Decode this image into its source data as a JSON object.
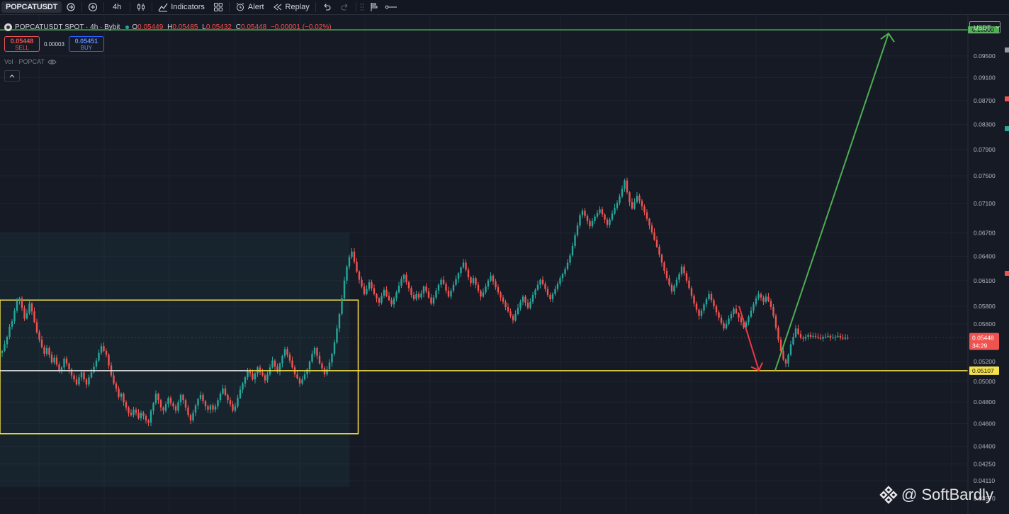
{
  "toolbar": {
    "symbol": "POPCATUSDT",
    "interval": "4h",
    "indicators_label": "Indicators",
    "alert_label": "Alert",
    "replay_label": "Replay"
  },
  "legend": {
    "title": "POPCATUSDT SPOT · 4h · Bybit",
    "o_label": "O",
    "o_value": "0.05449",
    "h_label": "H",
    "h_value": "0.05485",
    "l_label": "L",
    "l_value": "0.05432",
    "c_label": "C",
    "c_value": "0.05448",
    "change": "−0.00001 (−0.02%)"
  },
  "trade": {
    "sell_price": "0.05448",
    "sell_label": "SELL",
    "spread": "0.00003",
    "buy_price": "0.05451",
    "buy_label": "BUY"
  },
  "volume_label": "Vol · POPCAT",
  "currency": "USDT",
  "price_scale": {
    "ticks": [
      "0.09500",
      "0.09100",
      "0.08700",
      "0.08300",
      "0.07900",
      "0.07500",
      "0.07100",
      "0.06700",
      "0.06400",
      "0.06100",
      "0.05800",
      "0.05600",
      "0.05200",
      "0.05000",
      "0.04800",
      "0.04600",
      "0.04400",
      "0.04250",
      "0.04110",
      "0.03970"
    ],
    "top_label": "0.10000",
    "current_price": "0.05448",
    "countdown": "34:29",
    "level_label": "0.05107"
  },
  "watermark": "@ SoftBardly",
  "colors": {
    "up": "#26a69a",
    "down": "#ef5350",
    "support_box": "#f5e14a",
    "target_arrow": "#4caf50",
    "drop_arrow": "#f23645"
  },
  "chart_data": {
    "type": "candlestick",
    "y_scale": "log",
    "ylim": [
      0.0385,
      0.103
    ],
    "series": [
      {
        "name": "POPCATUSDT",
        "close": [
          0.0531,
          0.0538,
          0.0546,
          0.0557,
          0.0563,
          0.0575,
          0.0586,
          0.0589,
          0.0578,
          0.0566,
          0.0572,
          0.0583,
          0.0574,
          0.0562,
          0.0551,
          0.0543,
          0.0535,
          0.0528,
          0.0534,
          0.0527,
          0.0519,
          0.0524,
          0.0517,
          0.0511,
          0.0514,
          0.0523,
          0.0518,
          0.0512,
          0.0506,
          0.0502,
          0.0497,
          0.0504,
          0.0509,
          0.0502,
          0.0497,
          0.0504,
          0.0509,
          0.0515,
          0.0521,
          0.0529,
          0.0536,
          0.0531,
          0.0527,
          0.0516,
          0.0506,
          0.0498,
          0.0493,
          0.0485,
          0.0488,
          0.048,
          0.0475,
          0.047,
          0.0468,
          0.0473,
          0.047,
          0.0465,
          0.047,
          0.0467,
          0.0463,
          0.0461,
          0.0472,
          0.0479,
          0.0488,
          0.0482,
          0.0475,
          0.0472,
          0.0478,
          0.0484,
          0.0479,
          0.0476,
          0.0472,
          0.048,
          0.0487,
          0.0482,
          0.0475,
          0.0468,
          0.0463,
          0.047,
          0.0477,
          0.0483,
          0.0487,
          0.0481,
          0.0476,
          0.0473,
          0.0477,
          0.0473,
          0.0476,
          0.0482,
          0.0488,
          0.0493,
          0.0487,
          0.0482,
          0.0478,
          0.0472,
          0.0476,
          0.0484,
          0.0492,
          0.0498,
          0.0504,
          0.0511,
          0.0508,
          0.0502,
          0.0508,
          0.0514,
          0.0509,
          0.0506,
          0.0501,
          0.0507,
          0.0514,
          0.0521,
          0.0515,
          0.051,
          0.0518,
          0.0526,
          0.0533,
          0.0527,
          0.0521,
          0.0514,
          0.0507,
          0.0503,
          0.0498,
          0.0502,
          0.0507,
          0.0512,
          0.052,
          0.0528,
          0.0534,
          0.0526,
          0.0518,
          0.0513,
          0.0507,
          0.0512,
          0.0519,
          0.0528,
          0.054,
          0.0555,
          0.0571,
          0.0589,
          0.061,
          0.0627,
          0.0639,
          0.0646,
          0.0633,
          0.0621,
          0.0611,
          0.0603,
          0.0594,
          0.06,
          0.0608,
          0.0601,
          0.0594,
          0.0589,
          0.0584,
          0.0592,
          0.0599,
          0.0592,
          0.0587,
          0.0582,
          0.0589,
          0.0596,
          0.0604,
          0.0612,
          0.0617,
          0.0608,
          0.0601,
          0.0593,
          0.0588,
          0.0594,
          0.059,
          0.0595,
          0.0603,
          0.0597,
          0.059,
          0.0583,
          0.059,
          0.0598,
          0.0605,
          0.0611,
          0.0606,
          0.0598,
          0.0591,
          0.0598,
          0.0605,
          0.0612,
          0.0619,
          0.0626,
          0.0632,
          0.0623,
          0.0614,
          0.0607,
          0.0613,
          0.0605,
          0.0598,
          0.0591,
          0.0596,
          0.0603,
          0.061,
          0.0616,
          0.0609,
          0.0602,
          0.0596,
          0.059,
          0.0585,
          0.0579,
          0.0574,
          0.0569,
          0.0564,
          0.0571,
          0.0578,
          0.0585,
          0.0591,
          0.0584,
          0.0578,
          0.0585,
          0.0593,
          0.0599,
          0.0605,
          0.0611,
          0.0606,
          0.06,
          0.0593,
          0.0588,
          0.0594,
          0.06,
          0.0606,
          0.0613,
          0.0618,
          0.0624,
          0.0632,
          0.0641,
          0.0653,
          0.0667,
          0.068,
          0.0694,
          0.07,
          0.0693,
          0.0686,
          0.0679,
          0.0686,
          0.0692,
          0.0697,
          0.0702,
          0.0695,
          0.0688,
          0.0681,
          0.0688,
          0.0696,
          0.0704,
          0.0711,
          0.072,
          0.0731,
          0.0743,
          0.0726,
          0.0712,
          0.0703,
          0.0712,
          0.0721,
          0.0714,
          0.0706,
          0.0698,
          0.0689,
          0.068,
          0.0671,
          0.0661,
          0.0652,
          0.0642,
          0.0632,
          0.0622,
          0.0613,
          0.0605,
          0.0597,
          0.0604,
          0.0611,
          0.0618,
          0.0627,
          0.0619,
          0.061,
          0.0601,
          0.0592,
          0.0583,
          0.0576,
          0.0569,
          0.0575,
          0.0582,
          0.0588,
          0.0594,
          0.0587,
          0.058,
          0.0573,
          0.0567,
          0.0561,
          0.0555,
          0.056,
          0.0566,
          0.0571,
          0.0577,
          0.0572,
          0.0567,
          0.0562,
          0.0556,
          0.0562,
          0.0568,
          0.0575,
          0.0582,
          0.0589,
          0.0594,
          0.059,
          0.0585,
          0.0591,
          0.0586,
          0.0579,
          0.0569,
          0.0556,
          0.0543,
          0.0531,
          0.0522,
          0.0518,
          0.0527,
          0.0538,
          0.0546,
          0.0555,
          0.0549,
          0.0545,
          0.0544,
          0.0546,
          0.0548,
          0.0546,
          0.0547,
          0.0546,
          0.0545,
          0.0544,
          0.0546,
          0.0546,
          0.0547,
          0.0545,
          0.0545,
          0.0546,
          0.0547,
          0.0545,
          0.0544,
          0.0545,
          0.05448
        ]
      }
    ],
    "annotations": {
      "support_level": 0.05107,
      "target_level": 0.1,
      "accumulation_box": {
        "low": 0.0451,
        "high": 0.0587
      },
      "drop_arrow": {
        "from": 0.058,
        "to": 0.0511
      },
      "target_arrow": {
        "from": 0.0511,
        "to": 0.1
      }
    }
  }
}
